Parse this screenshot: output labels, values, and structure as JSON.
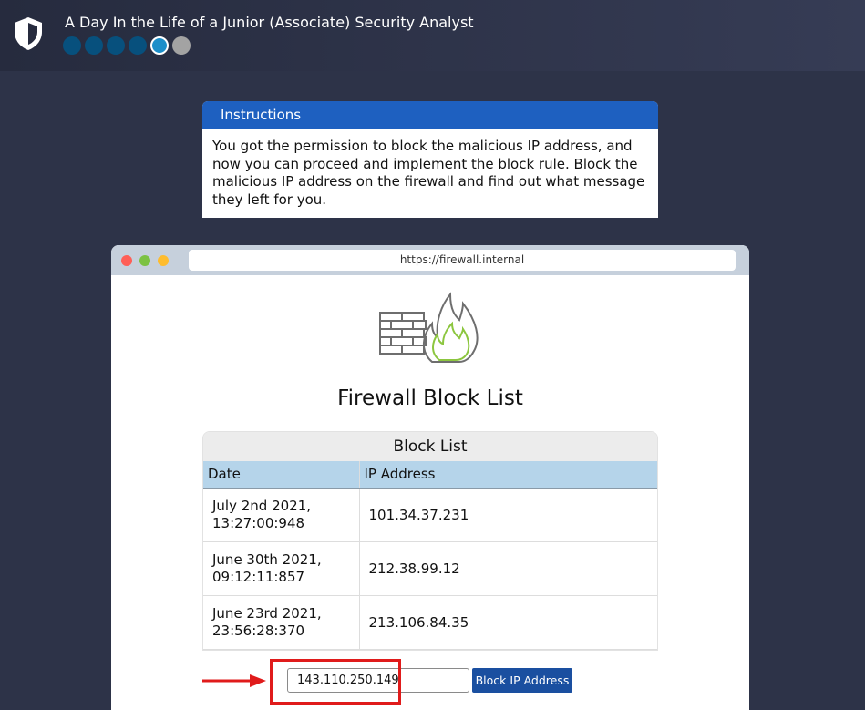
{
  "header": {
    "title": "A Day In the Life of a Junior (Associate) Security Analyst",
    "logo_icon": "shield-icon",
    "progress": {
      "total_steps": 6,
      "completed_steps": 4,
      "current_step": 5
    }
  },
  "instructions": {
    "title": "Instructions",
    "body": "You got the permission to block the malicious IP address, and now you can proceed and implement the block rule. Block the malicious IP address on the firewall and find out what message they left for you."
  },
  "browser": {
    "url": "https://firewall.internal",
    "icon": "firewall-flame-icon",
    "heading": "Firewall Block List",
    "block_list": {
      "title": "Block List",
      "columns": [
        "Date",
        "IP Address"
      ],
      "rows": [
        {
          "date_line1": "July 2nd 2021,",
          "date_line2": "13:27:00:948",
          "ip": "101.34.37.231"
        },
        {
          "date_line1": "June 30th 2021,",
          "date_line2": "09:12:11:857",
          "ip": "212.38.99.12"
        },
        {
          "date_line1": "June 23rd 2021,",
          "date_line2": "23:56:28:370",
          "ip": "213.106.84.35"
        }
      ]
    },
    "form": {
      "ip_value": "143.110.250.149",
      "button_label": "Block IP Address"
    }
  },
  "annotation": {
    "color": "#e01b1b",
    "icon": "arrow-right-icon"
  },
  "colors": {
    "background": "#2d3348",
    "instructions_header": "#1e60c0",
    "table_header": "#b5d4ea",
    "button": "#1a4fa0",
    "step_done": "#07507d",
    "step_current": "#1c8ec9",
    "step_upcoming": "#a3a3a3"
  }
}
